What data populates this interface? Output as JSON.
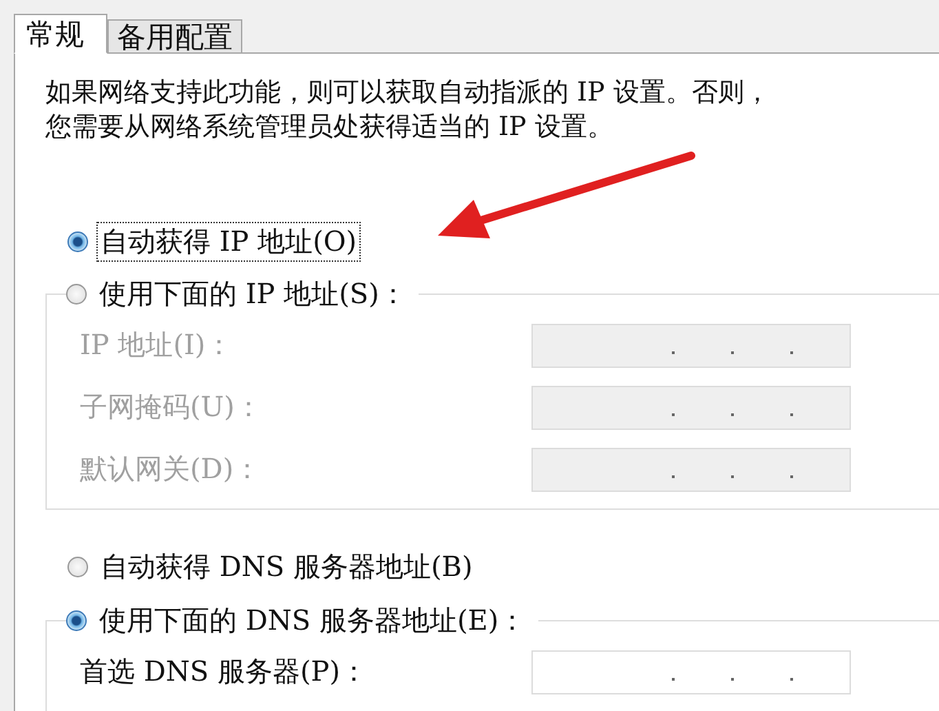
{
  "tabs": [
    {
      "label": "常规",
      "selected": true
    },
    {
      "label": "备用配置",
      "selected": false
    }
  ],
  "intro": "如果网络支持此功能，则可以获取自动指派的 IP 设置。否则，您需要从网络系统管理员处获得适当的 IP 设置。",
  "ip_mode": [
    {
      "label": "自动获得 IP 地址(O)",
      "selected": true,
      "focused": true
    },
    {
      "label": "使用下面的 IP 地址(S)：",
      "selected": false,
      "focused": false
    }
  ],
  "ip_fields": [
    {
      "label": "IP 地址(I)：",
      "disabled": true
    },
    {
      "label": "子网掩码(U)：",
      "disabled": true
    },
    {
      "label": "默认网关(D)：",
      "disabled": true
    }
  ],
  "dns_mode": [
    {
      "label": "自动获得 DNS 服务器地址(B)",
      "selected": false,
      "focused": false
    },
    {
      "label": "使用下面的 DNS 服务器地址(E)：",
      "selected": true,
      "focused": false
    }
  ],
  "dns_fields": [
    {
      "label": "首选 DNS 服务器(P)：",
      "disabled": false
    }
  ]
}
